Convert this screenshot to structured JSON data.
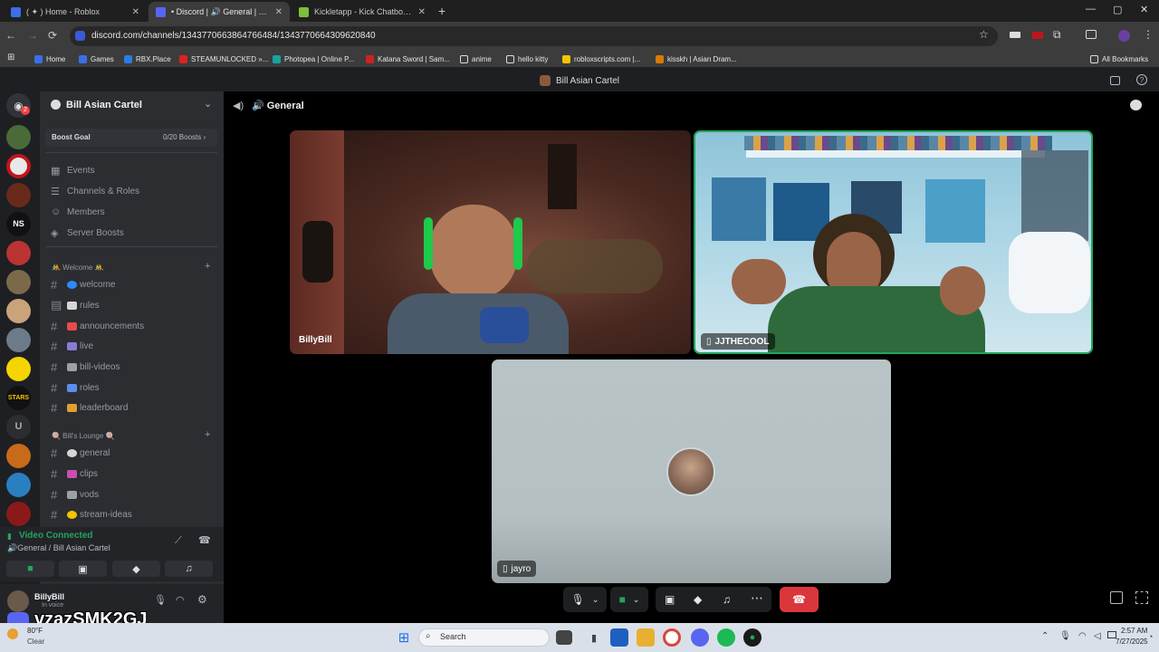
{
  "browser": {
    "tabs": [
      {
        "title": "( ✦ ) Home - Roblox",
        "close": "✕",
        "fav_color": "#3b6ee8"
      },
      {
        "title": "• Discord | 🔊 General | Bill Asian Cartel",
        "close": "✕",
        "fav_color": "#5865f2"
      },
      {
        "title": "Kickletapp - Kick Chatbot and Custom Commands",
        "close": "✕",
        "fav_color": "#7bbf3a"
      }
    ],
    "new_tab": "+",
    "window_controls": [
      "—",
      "▢",
      "✕"
    ],
    "url": "discord.com/channels/1343770663864766484/1343770664309620840",
    "nav": {
      "back": "←",
      "forward": "→",
      "reload": "⟳"
    },
    "bookmarks": [
      {
        "label": "Home",
        "color": "#3b6ee8"
      },
      {
        "label": "Games",
        "color": "#3b6ee8"
      },
      {
        "label": "RBX.Place",
        "color": "#2a7de1"
      },
      {
        "label": "STEAMUNLOCKED »...",
        "color": "#d22"
      },
      {
        "label": "Photopea | Online P...",
        "color": "#1aa39c"
      },
      {
        "label": "Katana Sword | Sam...",
        "color": "#c22"
      },
      {
        "label": "anime",
        "color": "#e6e6e6"
      },
      {
        "label": "hello kitty",
        "color": "#e6e6e6"
      },
      {
        "label": "robloxscripts.com |...",
        "color": "#f5c400"
      },
      {
        "label": "kisskh | Asian Dram...",
        "color": "#d97a00"
      }
    ],
    "all_bookmarks": "All Bookmarks"
  },
  "discord": {
    "window_title": "Bill Asian Cartel",
    "server_name": "Bill Asian Cartel",
    "boost": {
      "label": "Boost Goal",
      "value": "0/20 Boosts ›"
    },
    "menu": [
      {
        "label": "Events",
        "icon": "calendar-icon"
      },
      {
        "label": "Channels & Roles",
        "icon": "channels-icon"
      },
      {
        "label": "Members",
        "icon": "members-icon"
      },
      {
        "label": "Server Boosts",
        "icon": "boost-icon"
      }
    ],
    "category_welcome": "🤼 Welcome 🤼",
    "welcome_channels": [
      {
        "label": "welcome",
        "emoji_color": "#2f88ff"
      },
      {
        "label": "rules",
        "emoji_color": "#d6d6d6"
      },
      {
        "label": "announcements",
        "emoji_color": "#e84b4b"
      },
      {
        "label": "live",
        "emoji_color": "#8a7bd6"
      },
      {
        "label": "bill-videos",
        "emoji_color": "#9aa0a6"
      },
      {
        "label": "roles",
        "emoji_color": "#5b8def"
      },
      {
        "label": "leaderboard",
        "emoji_color": "#e0a030"
      }
    ],
    "category_lounge": "🍭 Bill's Lounge 🍭",
    "lounge_channels": [
      {
        "label": "general",
        "emoji_color": "#d6d6d6"
      },
      {
        "label": "clips",
        "emoji_color": "#c94fb0"
      },
      {
        "label": "vods",
        "emoji_color": "#9aa0a6"
      },
      {
        "label": "stream-ideas",
        "emoji_color": "#f5c400"
      }
    ],
    "voice": {
      "status": "Video Connected",
      "location": "🔊General / Bill Asian Cartel"
    },
    "user": {
      "name": "BillyBill",
      "status": "In voice"
    },
    "channel_header": "🔊 General",
    "participants": {
      "p1": "BillyBill",
      "p2": "JJTHECOOL",
      "p3": "jayro"
    }
  },
  "overlay_watermark": "vzazSMK2GJ",
  "taskbar": {
    "weather_temp": "80°F",
    "weather_desc": "Clear",
    "search": "Search",
    "time": "2:57 AM",
    "date": "7/27/2025"
  }
}
